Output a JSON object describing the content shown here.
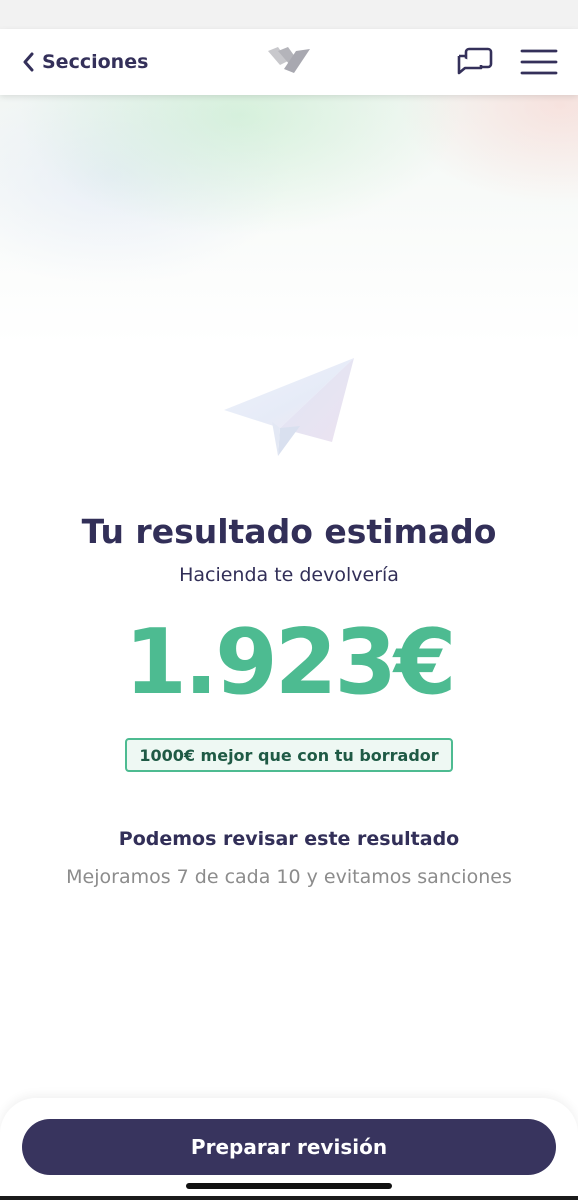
{
  "header": {
    "back_label": "Secciones",
    "icons": {
      "back": "chevron-left-icon",
      "logo": "brand-logo",
      "chat": "chat-icon",
      "menu": "hamburger-menu-icon"
    }
  },
  "main": {
    "title": "Tu resultado estimado",
    "subtitle": "Hacienda te devolvería",
    "amount": "1.923€",
    "badge": "1000€ mejor que con tu borrador",
    "review_title": "Podemos revisar este resultado",
    "review_subtitle": "Mejoramos 7 de cada 10 y evitamos sanciones"
  },
  "footer": {
    "cta_label": "Preparar revisión"
  },
  "colors": {
    "primary": "#38345e",
    "text_dark": "#322f58",
    "accent_green": "#4dbb91",
    "muted": "#8c8c8c"
  }
}
